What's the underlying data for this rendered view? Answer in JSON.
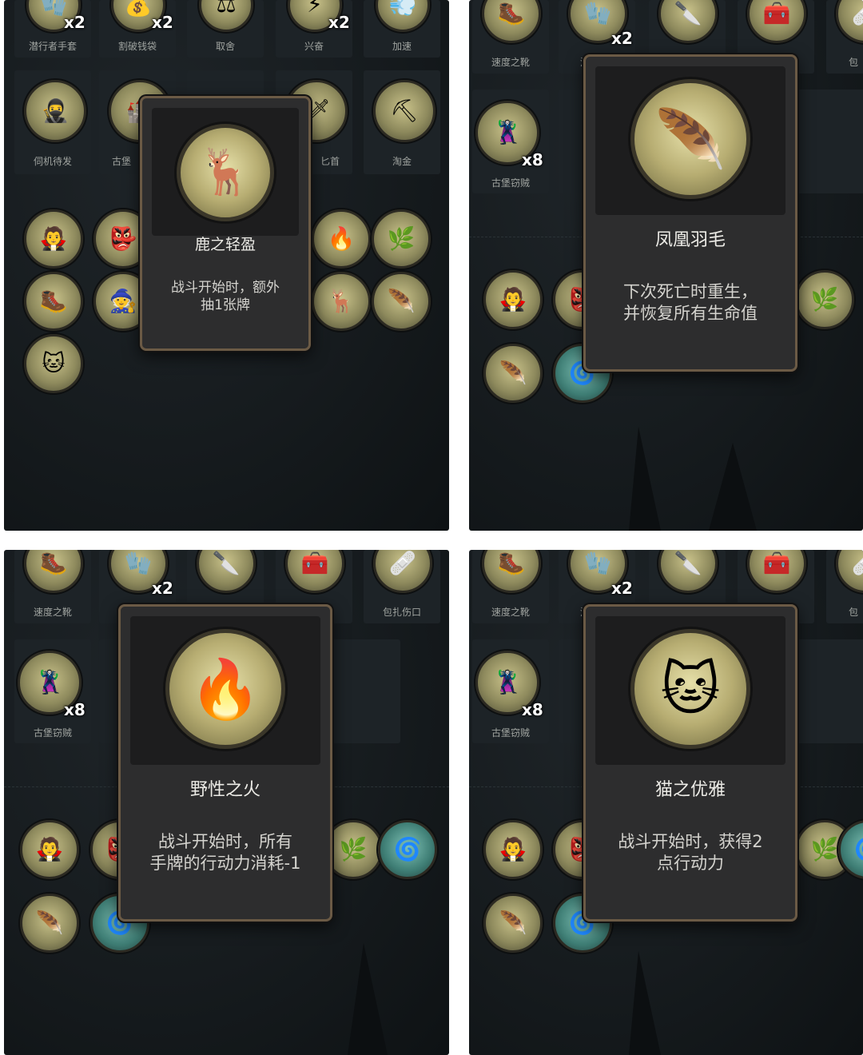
{
  "panel1": {
    "top_slots": [
      {
        "label": "潜行者手套",
        "mult": "x2"
      },
      {
        "label": "割破钱袋",
        "mult": "x2"
      },
      {
        "label": "取舍",
        "mult": ""
      },
      {
        "label": "兴奋",
        "mult": "x2"
      },
      {
        "label": "加速",
        "mult": ""
      }
    ],
    "mid_slots": [
      {
        "label": "伺机待发"
      },
      {
        "label": "古堡"
      },
      {
        "label": ""
      },
      {
        "label": "匕首"
      },
      {
        "label": "淘金"
      }
    ],
    "tooltip": {
      "name": "鹿之轻盈",
      "desc_line1": "战斗开始时，额外",
      "desc_line2": "抽1张牌"
    }
  },
  "panel2": {
    "top_slots": [
      {
        "label": "速度之靴",
        "mult": ""
      },
      {
        "label": "潜",
        "mult": "x2"
      },
      {
        "label": "",
        "mult": ""
      },
      {
        "label": "",
        "mult": ""
      },
      {
        "label": "包",
        "mult": ""
      }
    ],
    "mid_slot": {
      "label": "古堡窃贼",
      "mult": "x8"
    },
    "tooltip": {
      "name": "凤凰羽毛",
      "desc_line1": "下次死亡时重生，",
      "desc_line2": "并恢复所有生命值"
    }
  },
  "panel3": {
    "top_slots": [
      {
        "label": "速度之靴",
        "mult": ""
      },
      {
        "label": "潜",
        "mult": "x2"
      },
      {
        "label": "",
        "mult": ""
      },
      {
        "label": "",
        "mult": ""
      },
      {
        "label": "包扎伤口",
        "mult": ""
      }
    ],
    "mid_slot": {
      "label": "古堡窃贼",
      "mult": "x8"
    },
    "tooltip": {
      "name": "野性之火",
      "desc_line1": "战斗开始时，所有",
      "desc_line2": "手牌的行动力消耗-1"
    }
  },
  "panel4": {
    "top_slots": [
      {
        "label": "速度之靴",
        "mult": ""
      },
      {
        "label": "潜",
        "mult": "x2"
      },
      {
        "label": "",
        "mult": ""
      },
      {
        "label": "",
        "mult": ""
      },
      {
        "label": "包",
        "mult": ""
      }
    ],
    "mid_slot": {
      "label": "古堡窃贼",
      "mult": "x8"
    },
    "tooltip": {
      "name": "猫之优雅",
      "desc_line1": "战斗开始时，获得2",
      "desc_line2": "点行动力"
    }
  },
  "icons": {
    "deer": "deer-icon",
    "phoenix": "phoenix-feather-icon",
    "fire": "wild-fire-icon",
    "cat": "cat-icon",
    "thief": "thief-icon",
    "hood": "hooded-figure-icon",
    "boot": "boot-icon",
    "glove": "glove-icon"
  },
  "colors": {
    "panel_bg": "#161b1e",
    "tooltip_bg": "#2d2d2e",
    "tooltip_border": "#6b5a45",
    "label": "#9fa39f"
  }
}
